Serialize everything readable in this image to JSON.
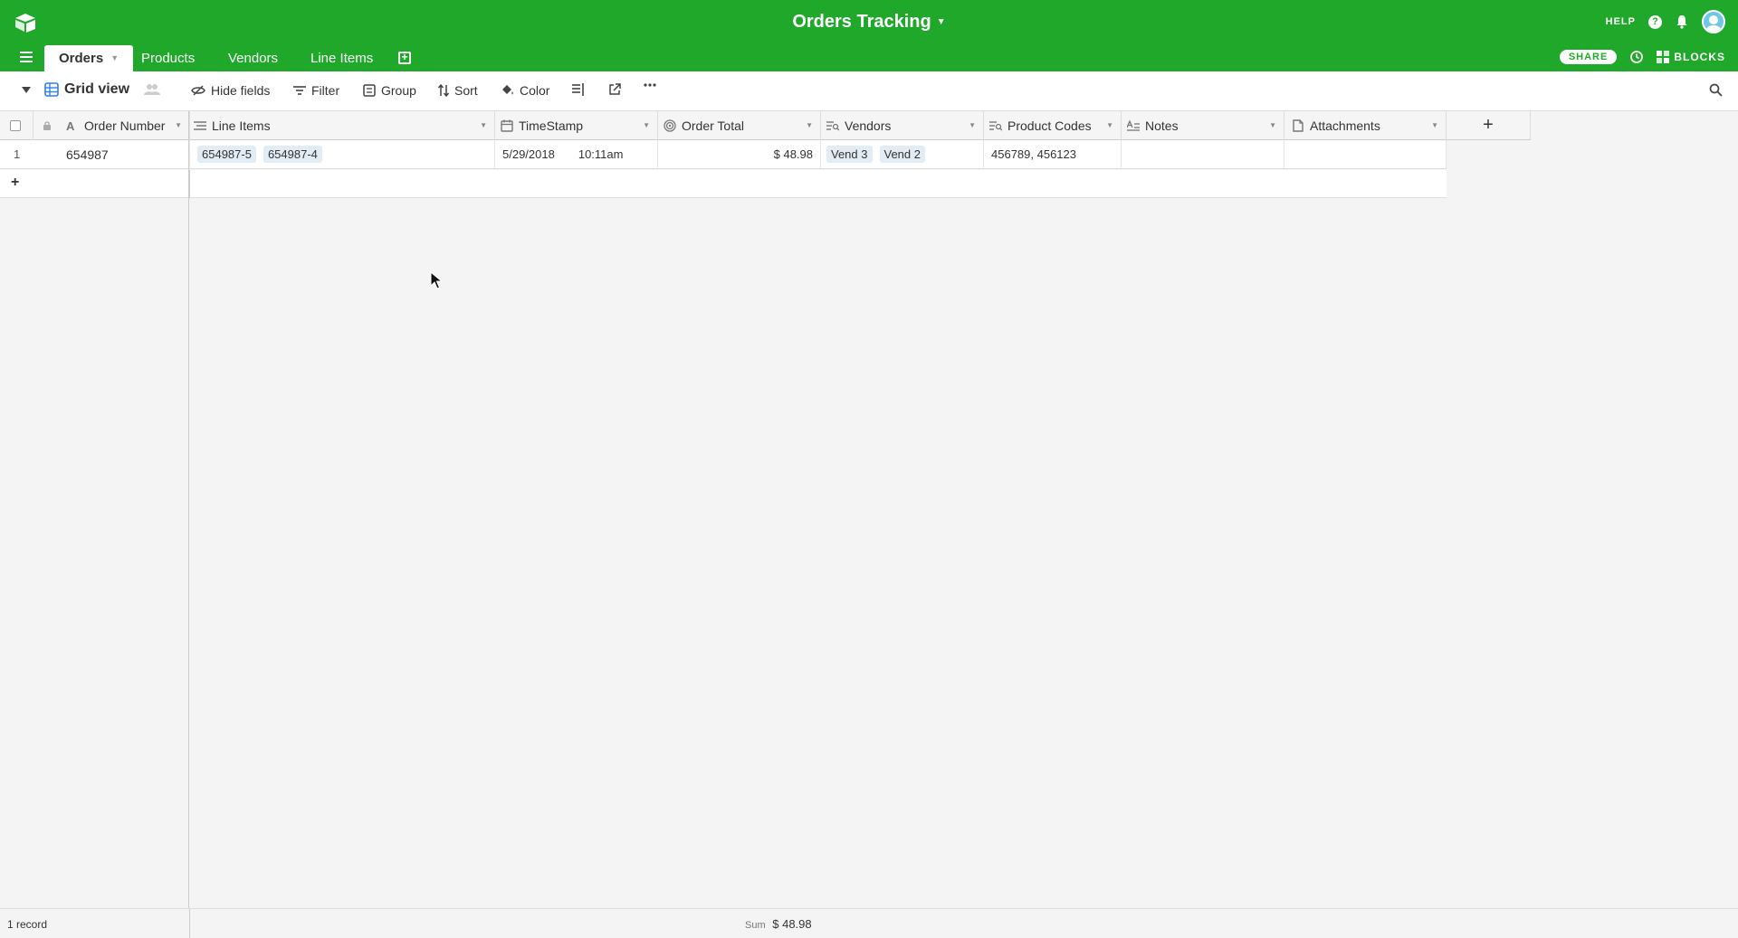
{
  "app": {
    "base_title": "Orders Tracking",
    "help_label": "HELP",
    "share_label": "SHARE",
    "blocks_label": "BLOCKS",
    "brand_color": "#20a82a"
  },
  "tables": [
    {
      "label": "Orders",
      "active": true
    },
    {
      "label": "Products",
      "active": false
    },
    {
      "label": "Vendors",
      "active": false
    },
    {
      "label": "Line Items",
      "active": false
    }
  ],
  "toolbar": {
    "view_name": "Grid view",
    "hide_fields": "Hide fields",
    "filter": "Filter",
    "group": "Group",
    "sort": "Sort",
    "color": "Color"
  },
  "columns": [
    {
      "label": "Order Number",
      "icon": "text-icon"
    },
    {
      "label": "Line Items",
      "icon": "link-icon"
    },
    {
      "label": "TimeStamp",
      "icon": "calendar-icon"
    },
    {
      "label": "Order Total",
      "icon": "rollup-icon"
    },
    {
      "label": "Vendors",
      "icon": "lookup-icon"
    },
    {
      "label": "Product Codes",
      "icon": "lookup-icon"
    },
    {
      "label": "Notes",
      "icon": "long-text-icon"
    },
    {
      "label": "Attachments",
      "icon": "attachment-icon"
    }
  ],
  "rows": [
    {
      "index": "1",
      "order_number": "654987",
      "line_items": [
        "654987-5",
        "654987-4"
      ],
      "date": "5/29/2018",
      "time": "10:11am",
      "order_total": "$ 48.98",
      "vendors": [
        "Vend 3",
        "Vend 2"
      ],
      "product_codes": "456789, 456123",
      "notes": "",
      "attachments": ""
    }
  ],
  "footer": {
    "record_count": "1 record",
    "sum_label": "Sum",
    "sum_value": "$ 48.98"
  }
}
